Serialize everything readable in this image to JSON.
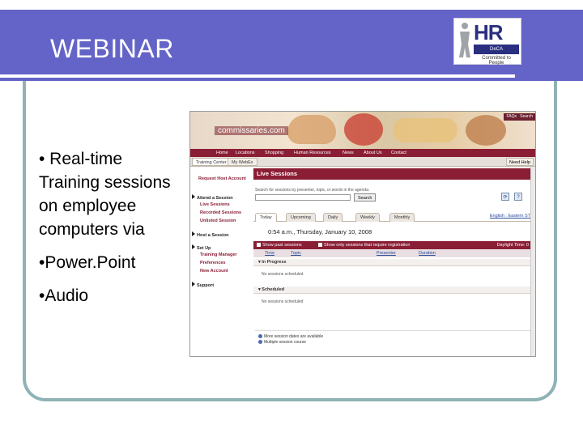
{
  "slide": {
    "title": "WEBINAR",
    "bullets": [
      "• Real-time Training sessions on employee computers via",
      "•Power.Point",
      "•Audio"
    ]
  },
  "logo": {
    "text": "HR",
    "subtitle": "DeCA HEADQUARTERS",
    "tagline": "Committed to People"
  },
  "screenshot": {
    "top_buttons": [
      "FAQs",
      "Search"
    ],
    "site_name": "commissaries.com",
    "nav": [
      "Home",
      "Locations",
      "Shopping",
      "Human Resources",
      "News",
      "About Us",
      "Contact"
    ],
    "tabs": [
      "Training Center",
      "My WebEx"
    ],
    "help_button": "Need Help",
    "left_nav": [
      {
        "label": "Request Host Account",
        "kind": "link"
      },
      {
        "label": "Attend a Session",
        "kind": "head"
      },
      {
        "label": "Live Sessions",
        "kind": "sub"
      },
      {
        "label": "Recorded Sessions",
        "kind": "sub"
      },
      {
        "label": "Unlisted Session",
        "kind": "sub"
      },
      {
        "label": "Host a Session",
        "kind": "head"
      },
      {
        "label": "Set Up",
        "kind": "head"
      },
      {
        "label": "Training Manager",
        "kind": "sub"
      },
      {
        "label": "Preferences",
        "kind": "sub"
      },
      {
        "label": "New Account",
        "kind": "sub"
      },
      {
        "label": "Support",
        "kind": "head"
      }
    ],
    "live_title": "Live Sessions",
    "search_help": "Search for sessions by presenter, topic, or words in the agenda:",
    "search_value": "",
    "search_button": "Search",
    "session_tabs": [
      "Today",
      "Upcoming",
      "Daily",
      "Weekly",
      "Monthly"
    ],
    "timezone_link": "English : Eastern ST",
    "date_line": "0:54 a.m., Thursday, January 10, 2008",
    "filter_left": "Show past sessions",
    "filter_mid": "Show only sessions that require registration",
    "filter_right": "Daylight Time: 0",
    "columns": [
      "Time",
      "Topic",
      "Presenter",
      "Duration"
    ],
    "group_in_progress": "In Progress",
    "empty_in_progress": "No sessions scheduled",
    "group_scheduled": "Scheduled",
    "empty_scheduled": "No sessions scheduled",
    "legend_1": "More session dates are available",
    "legend_2": "Multiple session course"
  }
}
